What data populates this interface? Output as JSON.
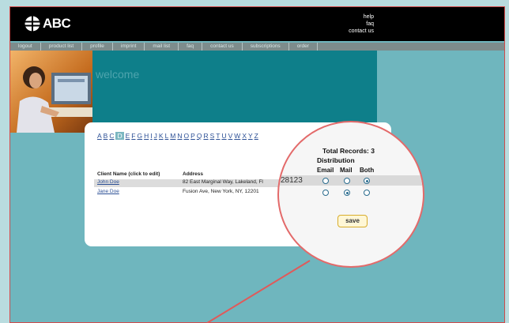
{
  "header": {
    "brand": "ABC",
    "links": [
      "help",
      "faq",
      "contact us"
    ]
  },
  "nav": [
    "logout",
    "product list",
    "profile",
    "imprint",
    "mail list",
    "faq",
    "contact us",
    "subscriptions",
    "order"
  ],
  "hero": {
    "welcome": "welcome"
  },
  "alphabet": [
    "A",
    "B",
    "C",
    "D",
    "E",
    "F",
    "G",
    "H",
    "I",
    "J",
    "K",
    "L",
    "M",
    "N",
    "O",
    "P",
    "Q",
    "R",
    "S",
    "T",
    "U",
    "V",
    "W",
    "X",
    "Y",
    "Z"
  ],
  "alphabet_selected": "D",
  "table": {
    "col_name": "Client Name (click to edit)",
    "col_address": "Address",
    "rows": [
      {
        "name": "John Doe",
        "address": "82 East Marginal Way, Lakeland, Fl"
      },
      {
        "name": "Jane Doe",
        "address": "Fusion Ave, New York, NY, 12201"
      }
    ]
  },
  "zoom": {
    "total_records": "Total Records: 3",
    "distribution": "Distribution",
    "headers": [
      "Email",
      "Mail",
      "Both"
    ],
    "zip_fragment": "28123",
    "row1_selected": "Both",
    "row2_selected": "Mail",
    "save_label": "save"
  },
  "colors": {
    "accent": "#0e7f8a",
    "link": "#2b4f95",
    "annotation": "#e05a5a"
  }
}
